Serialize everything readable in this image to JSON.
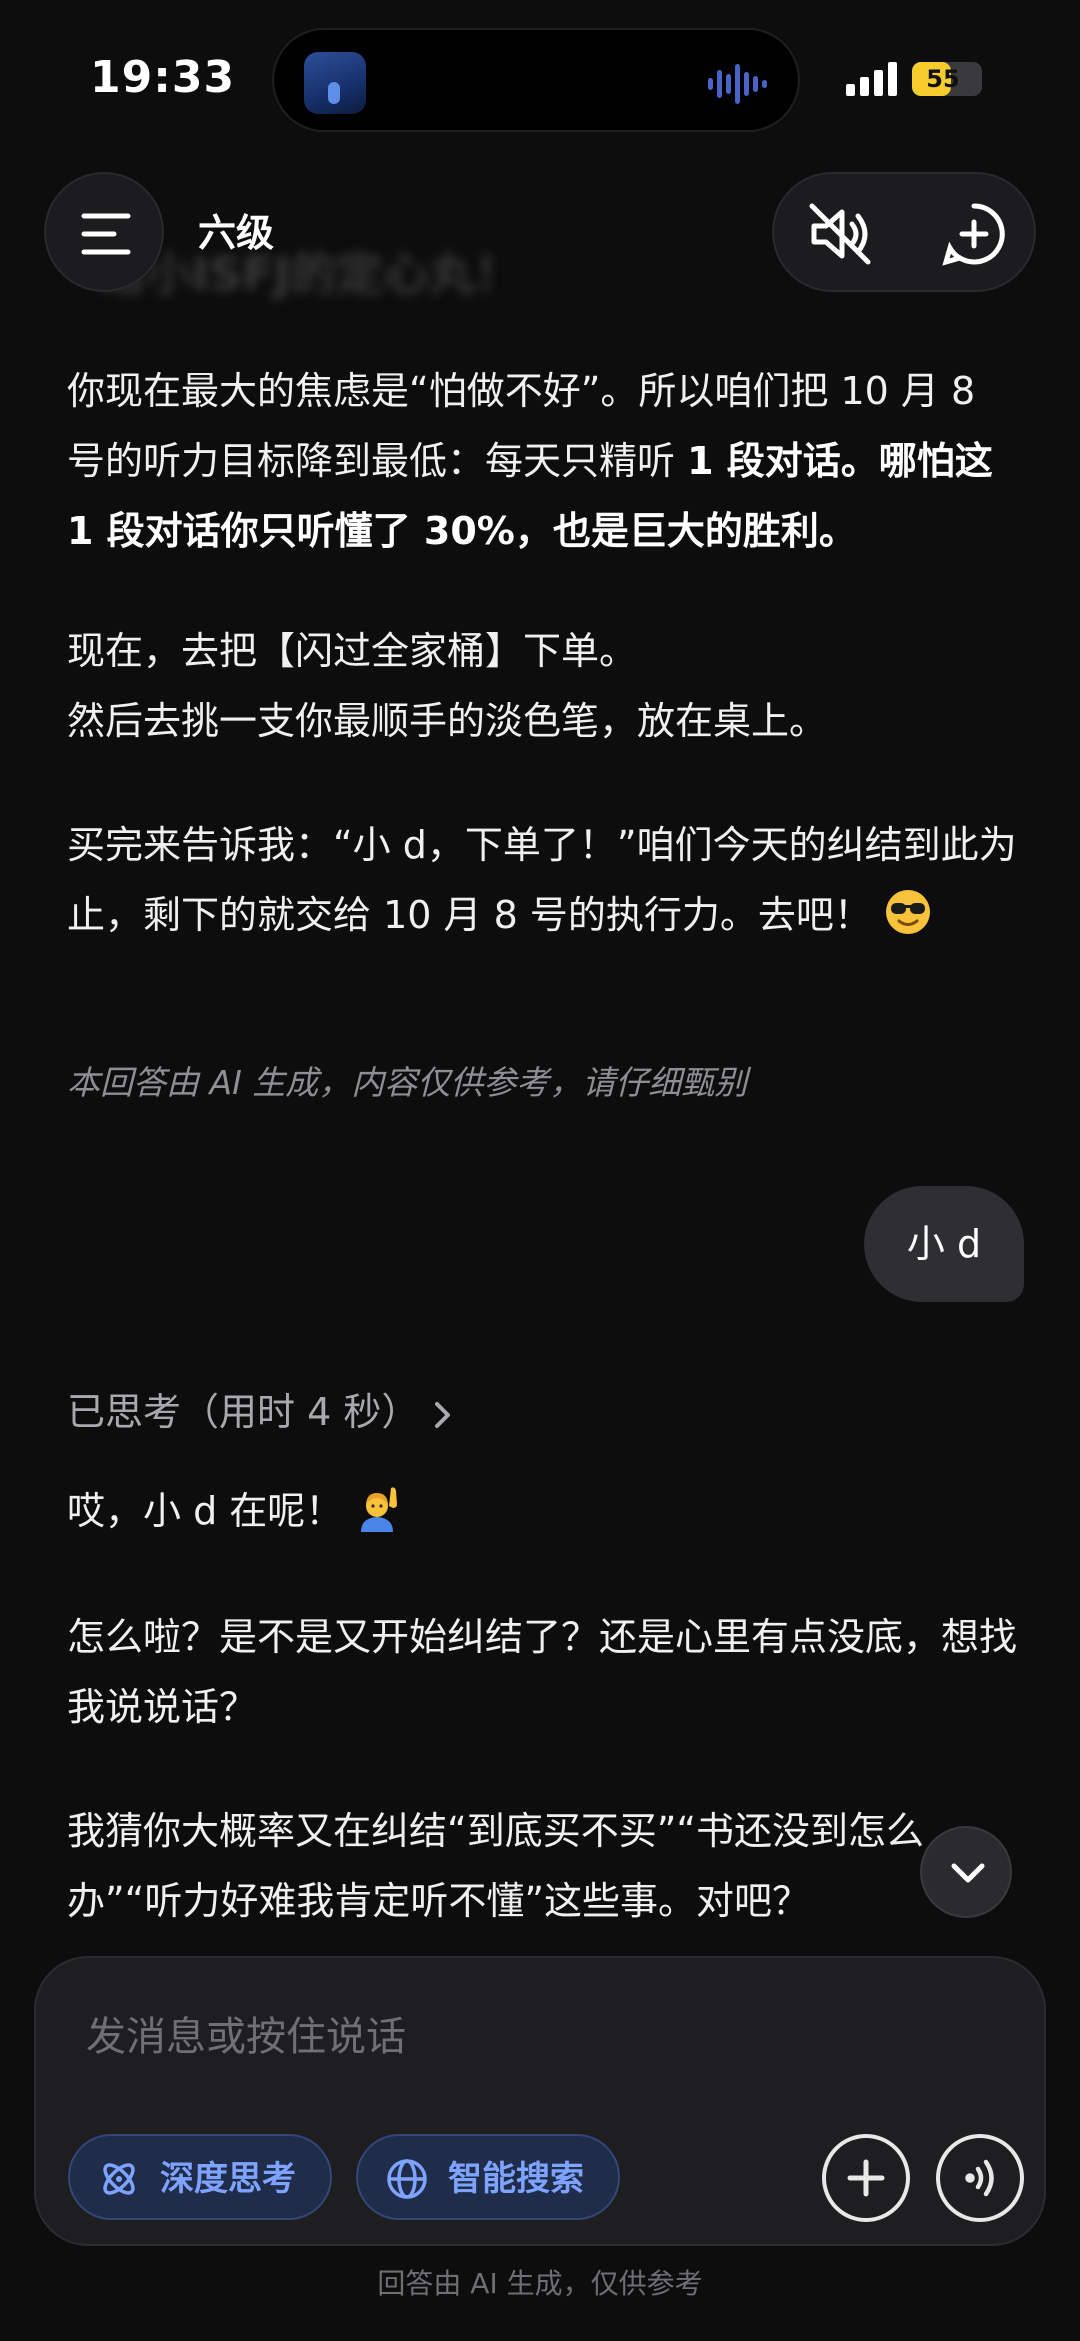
{
  "status_bar": {
    "time": "19:33",
    "battery_level": "55",
    "battery_fraction": 0.55,
    "battery_color": "#f6cd2d"
  },
  "header": {
    "title": "六级",
    "ghost_title": "给小ISFJ的定心丸！",
    "menu_icon": "hamburger-icon",
    "mute_icon": "speaker-muted-icon",
    "new_chat_icon": "new-chat-plus-icon"
  },
  "messages": {
    "assistant_1": {
      "p1_a": "你现在最大的焦虑是“怕做不好”。所以咱们把 10 月 8 号的听力目标降到最低：每天只精听 ",
      "p1_b": "1 段对话。哪怕这 1 段对话你只听懂了 30%，也是巨大的胜利。",
      "p2_l1": "现在，去把【闪过全家桶】下单。",
      "p2_l2": "然后去挑一支你最顺手的淡色笔，放在桌上。",
      "p3": "买完来告诉我：“小 d，下单了！”咱们今天的纠结到此为止，剩下的就交给 10 月 8 号的执行力。去吧！",
      "p3_emoji": "sunglasses-face-icon",
      "disclaimer": "本回答由 AI 生成，内容仅供参考，请仔细甄别"
    },
    "user_1": "小 d",
    "assistant_2": {
      "thought": "已思考（用时 4 秒）",
      "p1": "哎，小 d 在呢！",
      "p1_emoji": "person-raising-hand-icon",
      "p2": "怎么啦？是不是又开始纠结了？还是心里有点没底，想找我说说话？",
      "p3": "我猜你大概率又在纠结“到底买不买”“书还没到怎么办”“听力好难我肯定听不懂”这些事。对吧？"
    }
  },
  "composer": {
    "placeholder": "发消息或按住说话",
    "deep_think": "深度思考",
    "smart_search": "智能搜索",
    "accent_color": "#7ea3ff"
  },
  "footer_note": "回答由 AI 生成，仅供参考"
}
